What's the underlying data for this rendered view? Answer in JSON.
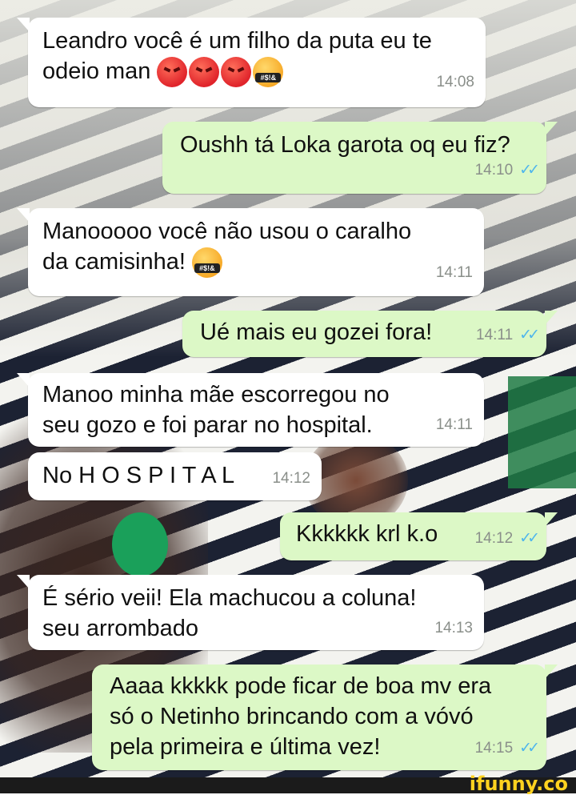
{
  "messages": [
    {
      "id": 1,
      "dir": "in",
      "lines": [
        "Leandro você é um filho da puta eu te",
        "odeio man"
      ],
      "time": "14:08",
      "emoji": "angry-x3-cursing"
    },
    {
      "id": 2,
      "dir": "out",
      "lines": [
        "Oushh tá Loka garota oq eu fiz?"
      ],
      "time": "14:10",
      "read": true
    },
    {
      "id": 3,
      "dir": "in",
      "lines": [
        "Manooooo você não usou o caralho",
        "da camisinha!"
      ],
      "time": "14:11",
      "emoji": "cursing"
    },
    {
      "id": 4,
      "dir": "out",
      "lines": [
        "Ué mais eu gozei fora!"
      ],
      "time": "14:11",
      "read": true
    },
    {
      "id": 5,
      "dir": "in",
      "lines": [
        "Manoo minha mãe escorregou no",
        "seu gozo e foi parar no hospital."
      ],
      "time": "14:11"
    },
    {
      "id": 6,
      "dir": "in",
      "lines": [
        "No H O S P I T A L"
      ],
      "time": "14:12"
    },
    {
      "id": 7,
      "dir": "out",
      "lines": [
        "Kkkkkk krl k.o"
      ],
      "time": "14:12",
      "read": true
    },
    {
      "id": 8,
      "dir": "in",
      "lines": [
        "É sério veii! Ela machucou a coluna!",
        "seu arrombado"
      ],
      "time": "14:13"
    },
    {
      "id": 9,
      "dir": "out",
      "lines": [
        "Aaaa kkkkk pode ficar de boa mv era",
        "só o Netinho brincando com a vóvó",
        "pela primeira e última vez!"
      ],
      "time": "14:15",
      "read": true
    }
  ],
  "read_ticks": "✓✓",
  "cursing_label": "#$!&",
  "watermark": "ifunny.co",
  "colors": {
    "incoming": "#ffffff",
    "outgoing": "#dcf8c6",
    "read_tick": "#4fb6ec",
    "timestamp": "#8a8f8a"
  }
}
